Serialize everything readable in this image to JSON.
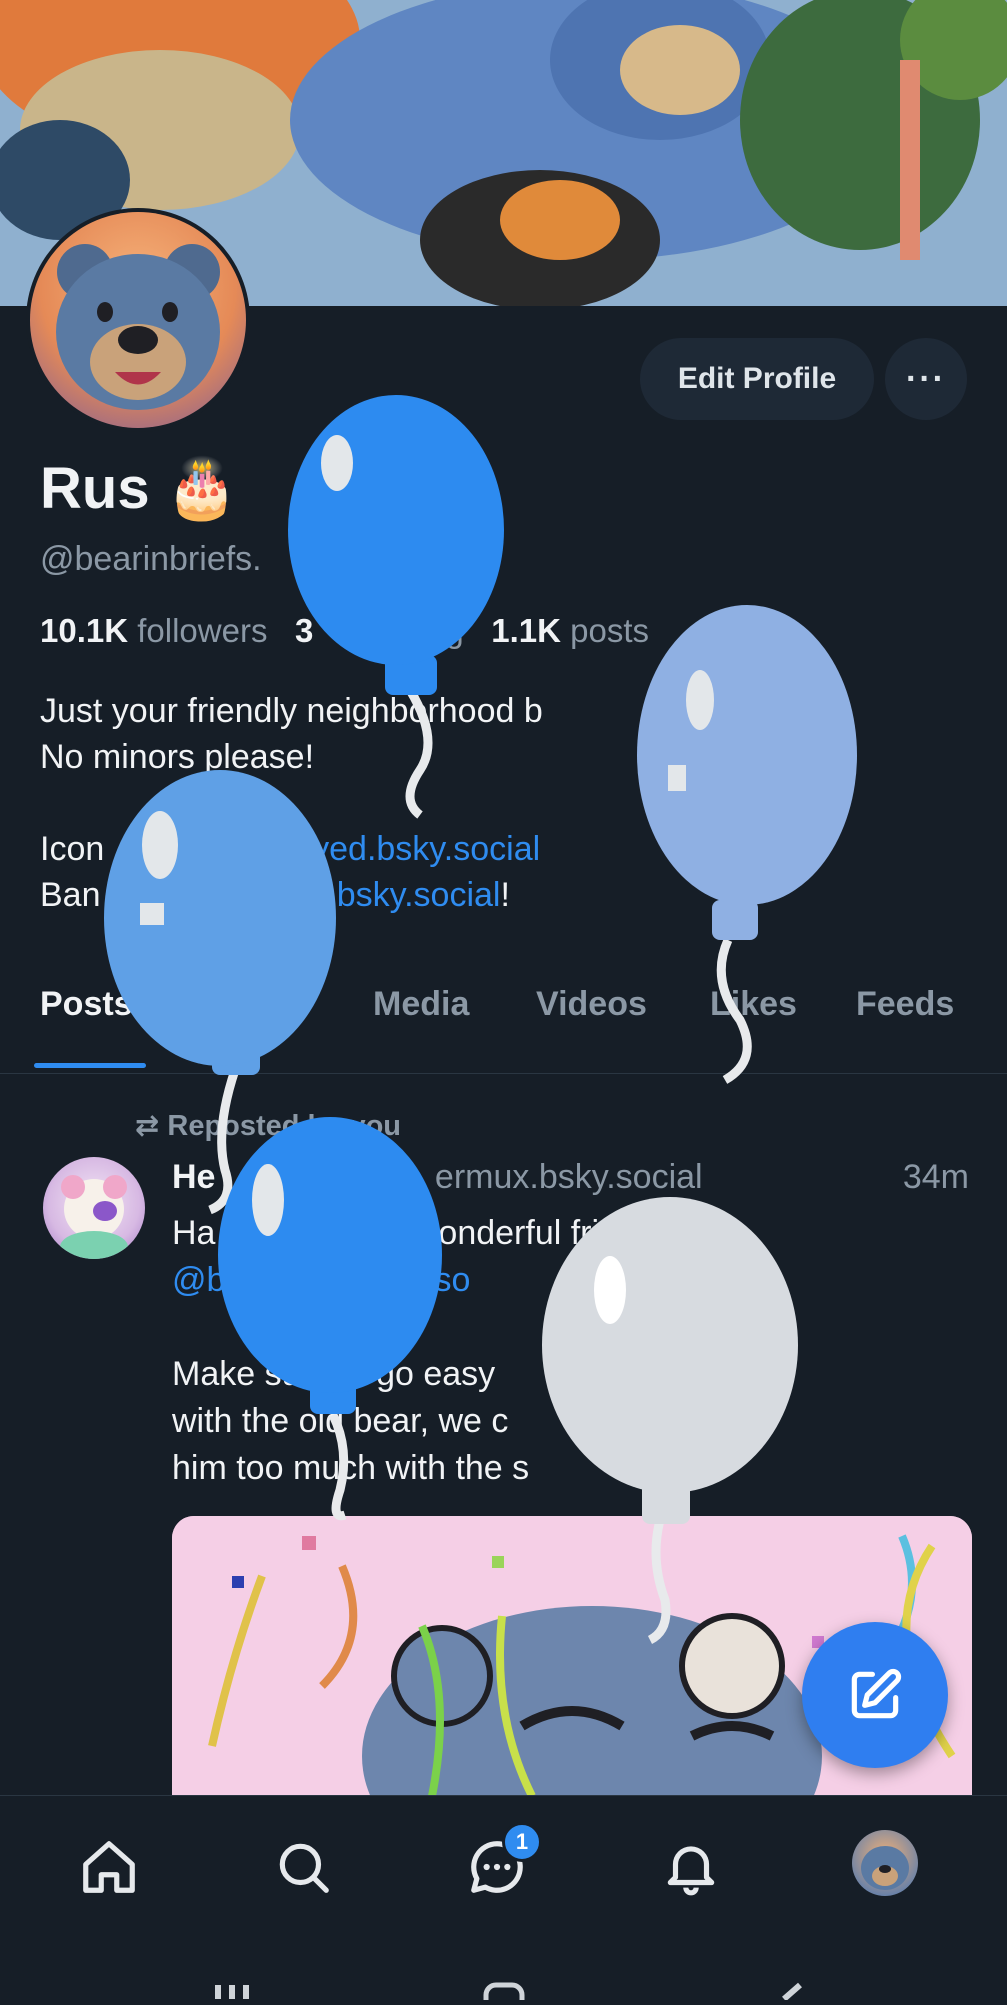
{
  "profile": {
    "name": "Rus 🎂",
    "handle": "@bearinbriefs.",
    "followers_count": "10.1K",
    "followers_label": "followers",
    "following_count": "3",
    "following_label": "owing",
    "posts_count": "1.1K",
    "posts_label": "posts",
    "bio_line1": "Just your friendly neighborhood b",
    "bio_line2": "No minors please!",
    "icon_prefix": "Icon",
    "icon_link": "odbyed.bsky.social",
    "banner_prefix": "Ban",
    "banner_link": "gan.bsky.social",
    "banner_suffix": "!"
  },
  "buttons": {
    "edit_profile": "Edit Profile",
    "more": "···"
  },
  "tabs": [
    "Posts",
    "es",
    "Media",
    "Videos",
    "Likes",
    "Feeds"
  ],
  "post": {
    "repost_label": "Reposted by you",
    "author": "He",
    "handle": "ermux.bsky.social",
    "time": "34m",
    "line1": "Ha              to a wonderful friend!!",
    "line2": "@b                sky.so",
    "line3": "Make su    to go easy              poppers",
    "line4": "with the old bear, we c            surprise",
    "line5": "him too much with the s          s"
  },
  "nav": {
    "messages_badge": "1"
  },
  "colors": {
    "background": "#161e27",
    "accent": "#2f8cf0",
    "muted": "#8b98a5"
  }
}
